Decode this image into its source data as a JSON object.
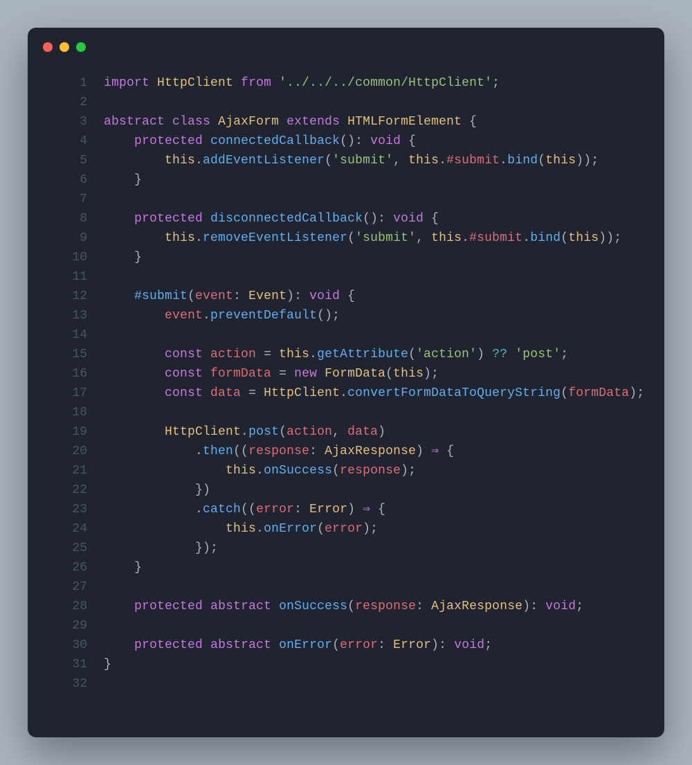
{
  "window": {
    "dots": [
      "red",
      "yellow",
      "green"
    ]
  },
  "colors": {
    "background_page": "#aab3c0",
    "background_editor": "#1f2430",
    "gutter": "#4a5568",
    "text": "#cbd0dc",
    "keyword": "#c678dd",
    "class": "#e5c07b",
    "function": "#61afef",
    "property": "#e06c75",
    "string": "#98c379",
    "operator": "#56b6c2"
  },
  "code": {
    "lines": [
      {
        "n": 1,
        "tokens": [
          [
            "kw",
            "import"
          ],
          [
            "pun",
            " "
          ],
          [
            "cls",
            "HttpClient"
          ],
          [
            "pun",
            " "
          ],
          [
            "kw",
            "from"
          ],
          [
            "pun",
            " "
          ],
          [
            "str",
            "'../../../common/HttpClient'"
          ],
          [
            "pun",
            ";"
          ]
        ]
      },
      {
        "n": 2,
        "tokens": []
      },
      {
        "n": 3,
        "tokens": [
          [
            "kw",
            "abstract"
          ],
          [
            "pun",
            " "
          ],
          [
            "kw",
            "class"
          ],
          [
            "pun",
            " "
          ],
          [
            "cls",
            "AjaxForm"
          ],
          [
            "pun",
            " "
          ],
          [
            "kw",
            "extends"
          ],
          [
            "pun",
            " "
          ],
          [
            "cls",
            "HTMLFormElement"
          ],
          [
            "pun",
            " {"
          ]
        ]
      },
      {
        "n": 4,
        "tokens": [
          [
            "pun",
            "    "
          ],
          [
            "kw",
            "protected"
          ],
          [
            "pun",
            " "
          ],
          [
            "fn",
            "connectedCallback"
          ],
          [
            "pun",
            "(): "
          ],
          [
            "kw",
            "void"
          ],
          [
            "pun",
            " {"
          ]
        ]
      },
      {
        "n": 5,
        "tokens": [
          [
            "pun",
            "        "
          ],
          [
            "this",
            "this"
          ],
          [
            "pun",
            "."
          ],
          [
            "fn",
            "addEventListener"
          ],
          [
            "pun",
            "("
          ],
          [
            "str",
            "'submit'"
          ],
          [
            "pun",
            ", "
          ],
          [
            "this",
            "this"
          ],
          [
            "pun",
            "."
          ],
          [
            "prop",
            "#submit"
          ],
          [
            "pun",
            "."
          ],
          [
            "fn",
            "bind"
          ],
          [
            "pun",
            "("
          ],
          [
            "this",
            "this"
          ],
          [
            "pun",
            "));"
          ]
        ]
      },
      {
        "n": 6,
        "tokens": [
          [
            "pun",
            "    }"
          ]
        ]
      },
      {
        "n": 7,
        "tokens": []
      },
      {
        "n": 8,
        "tokens": [
          [
            "pun",
            "    "
          ],
          [
            "kw",
            "protected"
          ],
          [
            "pun",
            " "
          ],
          [
            "fn",
            "disconnectedCallback"
          ],
          [
            "pun",
            "(): "
          ],
          [
            "kw",
            "void"
          ],
          [
            "pun",
            " {"
          ]
        ]
      },
      {
        "n": 9,
        "tokens": [
          [
            "pun",
            "        "
          ],
          [
            "this",
            "this"
          ],
          [
            "pun",
            "."
          ],
          [
            "fn",
            "removeEventListener"
          ],
          [
            "pun",
            "("
          ],
          [
            "str",
            "'submit'"
          ],
          [
            "pun",
            ", "
          ],
          [
            "this",
            "this"
          ],
          [
            "pun",
            "."
          ],
          [
            "prop",
            "#submit"
          ],
          [
            "pun",
            "."
          ],
          [
            "fn",
            "bind"
          ],
          [
            "pun",
            "("
          ],
          [
            "this",
            "this"
          ],
          [
            "pun",
            "));"
          ]
        ]
      },
      {
        "n": 10,
        "tokens": [
          [
            "pun",
            "    }"
          ]
        ]
      },
      {
        "n": 11,
        "tokens": []
      },
      {
        "n": 12,
        "tokens": [
          [
            "pun",
            "    "
          ],
          [
            "fn",
            "#submit"
          ],
          [
            "pun",
            "("
          ],
          [
            "var",
            "event"
          ],
          [
            "pun",
            ": "
          ],
          [
            "cls",
            "Event"
          ],
          [
            "pun",
            "): "
          ],
          [
            "kw",
            "void"
          ],
          [
            "pun",
            " {"
          ]
        ]
      },
      {
        "n": 13,
        "tokens": [
          [
            "pun",
            "        "
          ],
          [
            "var",
            "event"
          ],
          [
            "pun",
            "."
          ],
          [
            "fn",
            "preventDefault"
          ],
          [
            "pun",
            "();"
          ]
        ]
      },
      {
        "n": 14,
        "tokens": []
      },
      {
        "n": 15,
        "tokens": [
          [
            "pun",
            "        "
          ],
          [
            "kw",
            "const"
          ],
          [
            "pun",
            " "
          ],
          [
            "var",
            "action"
          ],
          [
            "pun",
            " = "
          ],
          [
            "this",
            "this"
          ],
          [
            "pun",
            "."
          ],
          [
            "fn",
            "getAttribute"
          ],
          [
            "pun",
            "("
          ],
          [
            "str",
            "'action'"
          ],
          [
            "pun",
            ") "
          ],
          [
            "op",
            "??"
          ],
          [
            "pun",
            " "
          ],
          [
            "str",
            "'post'"
          ],
          [
            "pun",
            ";"
          ]
        ]
      },
      {
        "n": 16,
        "tokens": [
          [
            "pun",
            "        "
          ],
          [
            "kw",
            "const"
          ],
          [
            "pun",
            " "
          ],
          [
            "var",
            "formData"
          ],
          [
            "pun",
            " = "
          ],
          [
            "kw",
            "new"
          ],
          [
            "pun",
            " "
          ],
          [
            "cls",
            "FormData"
          ],
          [
            "pun",
            "("
          ],
          [
            "this",
            "this"
          ],
          [
            "pun",
            ");"
          ]
        ]
      },
      {
        "n": 17,
        "tokens": [
          [
            "pun",
            "        "
          ],
          [
            "kw",
            "const"
          ],
          [
            "pun",
            " "
          ],
          [
            "var",
            "data"
          ],
          [
            "pun",
            " = "
          ],
          [
            "cls",
            "HttpClient"
          ],
          [
            "pun",
            "."
          ],
          [
            "fn",
            "convertFormDataToQueryString"
          ],
          [
            "pun",
            "("
          ],
          [
            "var",
            "formData"
          ],
          [
            "pun",
            ");"
          ]
        ]
      },
      {
        "n": 18,
        "tokens": []
      },
      {
        "n": 19,
        "tokens": [
          [
            "pun",
            "        "
          ],
          [
            "cls",
            "HttpClient"
          ],
          [
            "pun",
            "."
          ],
          [
            "fn",
            "post"
          ],
          [
            "pun",
            "("
          ],
          [
            "var",
            "action"
          ],
          [
            "pun",
            ", "
          ],
          [
            "var",
            "data"
          ],
          [
            "pun",
            ")"
          ]
        ]
      },
      {
        "n": 20,
        "tokens": [
          [
            "pun",
            "            ."
          ],
          [
            "fn",
            "then"
          ],
          [
            "pun",
            "(("
          ],
          [
            "var",
            "response"
          ],
          [
            "pun",
            ": "
          ],
          [
            "cls",
            "AjaxResponse"
          ],
          [
            "pun",
            ") "
          ],
          [
            "kw",
            "⇒"
          ],
          [
            "pun",
            " {"
          ]
        ]
      },
      {
        "n": 21,
        "tokens": [
          [
            "pun",
            "                "
          ],
          [
            "this",
            "this"
          ],
          [
            "pun",
            "."
          ],
          [
            "fn",
            "onSuccess"
          ],
          [
            "pun",
            "("
          ],
          [
            "var",
            "response"
          ],
          [
            "pun",
            ");"
          ]
        ]
      },
      {
        "n": 22,
        "tokens": [
          [
            "pun",
            "            })"
          ]
        ]
      },
      {
        "n": 23,
        "tokens": [
          [
            "pun",
            "            ."
          ],
          [
            "fn",
            "catch"
          ],
          [
            "pun",
            "(("
          ],
          [
            "var",
            "error"
          ],
          [
            "pun",
            ": "
          ],
          [
            "cls",
            "Error"
          ],
          [
            "pun",
            ") "
          ],
          [
            "kw",
            "⇒"
          ],
          [
            "pun",
            " {"
          ]
        ]
      },
      {
        "n": 24,
        "tokens": [
          [
            "pun",
            "                "
          ],
          [
            "this",
            "this"
          ],
          [
            "pun",
            "."
          ],
          [
            "fn",
            "onError"
          ],
          [
            "pun",
            "("
          ],
          [
            "var",
            "error"
          ],
          [
            "pun",
            ");"
          ]
        ]
      },
      {
        "n": 25,
        "tokens": [
          [
            "pun",
            "            });"
          ]
        ]
      },
      {
        "n": 26,
        "tokens": [
          [
            "pun",
            "    }"
          ]
        ]
      },
      {
        "n": 27,
        "tokens": []
      },
      {
        "n": 28,
        "tokens": [
          [
            "pun",
            "    "
          ],
          [
            "kw",
            "protected"
          ],
          [
            "pun",
            " "
          ],
          [
            "kw",
            "abstract"
          ],
          [
            "pun",
            " "
          ],
          [
            "fn",
            "onSuccess"
          ],
          [
            "pun",
            "("
          ],
          [
            "var",
            "response"
          ],
          [
            "pun",
            ": "
          ],
          [
            "cls",
            "AjaxResponse"
          ],
          [
            "pun",
            "): "
          ],
          [
            "kw",
            "void"
          ],
          [
            "pun",
            ";"
          ]
        ]
      },
      {
        "n": 29,
        "tokens": []
      },
      {
        "n": 30,
        "tokens": [
          [
            "pun",
            "    "
          ],
          [
            "kw",
            "protected"
          ],
          [
            "pun",
            " "
          ],
          [
            "kw",
            "abstract"
          ],
          [
            "pun",
            " "
          ],
          [
            "fn",
            "onError"
          ],
          [
            "pun",
            "("
          ],
          [
            "var",
            "error"
          ],
          [
            "pun",
            ": "
          ],
          [
            "cls",
            "Error"
          ],
          [
            "pun",
            "): "
          ],
          [
            "kw",
            "void"
          ],
          [
            "pun",
            ";"
          ]
        ]
      },
      {
        "n": 31,
        "tokens": [
          [
            "pun",
            "}"
          ]
        ]
      },
      {
        "n": 32,
        "tokens": []
      }
    ]
  }
}
